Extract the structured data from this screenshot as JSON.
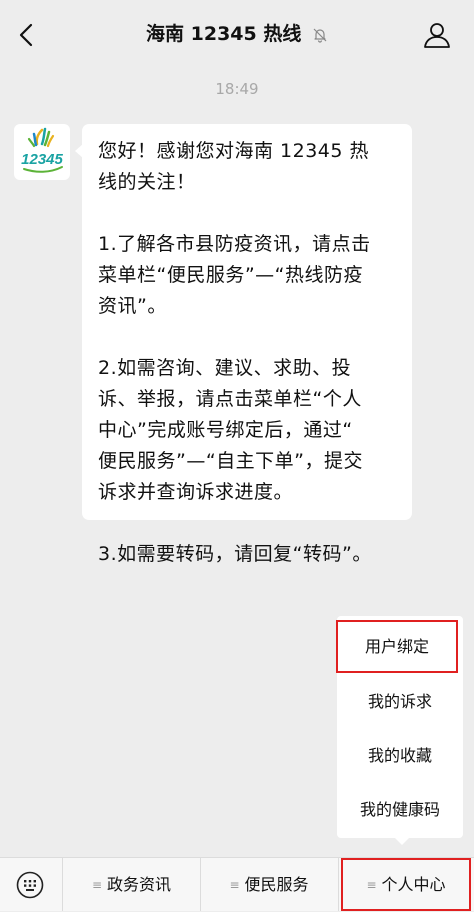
{
  "header": {
    "title": "海南 12345 热线",
    "back_icon": "chevron-left-icon",
    "mute_icon": "bell-muted-icon",
    "profile_icon": "user-icon"
  },
  "chat": {
    "timestamp": "18:49",
    "avatar": {
      "logo_text": "12345",
      "colors": {
        "gold": "#e8b21e",
        "teal": "#1aa3a3",
        "green": "#5cb338",
        "blue": "#1e88c8"
      }
    },
    "message_paragraphs": [
      [
        "您好！感谢您对海南 12345 热",
        "线的关注！"
      ],
      [
        "1.了解各市县防疫资讯，请点击",
        "菜单栏“便民服务”—“热线防疫",
        "资讯”。"
      ],
      [
        "2.如需咨询、建议、求助、投",
        "诉、举报，请点击菜单栏“个人",
        "中心”完成账号绑定后，通过“",
        "便民服务”—“自主下单”，提交",
        "诉求并查询诉求进度。"
      ],
      [
        "3.如需要转码，请回复“转码”。"
      ]
    ]
  },
  "popup_menu": {
    "items": [
      "用户绑定",
      "我的诉求",
      "我的收藏",
      "我的健康码"
    ]
  },
  "bottom_menu": {
    "keyboard_icon": "keyboard-icon",
    "tab_glyph": "≡",
    "tabs": [
      "政务资讯",
      "便民服务",
      "个人中心"
    ]
  },
  "colors": {
    "background": "#ededed",
    "bubble": "#ffffff",
    "highlight": "#e02020",
    "timestamp": "#a8a8a8"
  }
}
